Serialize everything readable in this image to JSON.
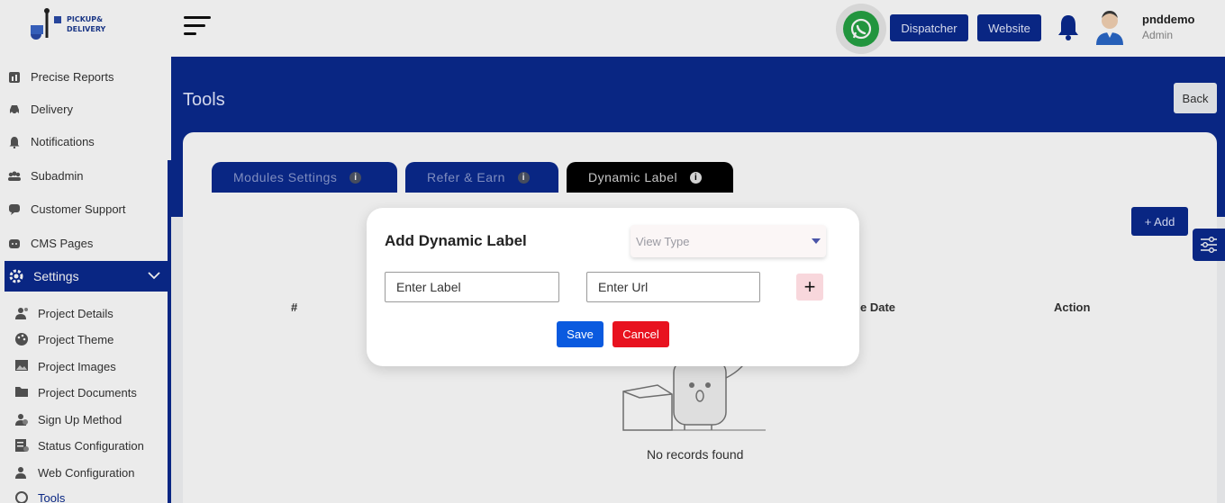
{
  "header": {
    "logo_text_line1": "PICKUP&",
    "logo_text_line2": "DELIVERY",
    "dispatcher_label": "Dispatcher",
    "website_label": "Website",
    "user_name": "pnddemo",
    "user_role": "Admin"
  },
  "sidebar": {
    "items": [
      {
        "label": "Precise Reports",
        "icon": "reports-icon"
      },
      {
        "label": "Delivery",
        "icon": "car-icon"
      },
      {
        "label": "Notifications",
        "icon": "bell-icon"
      },
      {
        "label": "Subadmin",
        "icon": "users-icon"
      },
      {
        "label": "Customer Support",
        "icon": "chat-icon"
      },
      {
        "label": "CMS Pages",
        "icon": "cms-icon"
      }
    ],
    "settings_label": "Settings",
    "sub_items": [
      {
        "label": "Project Details",
        "icon": "person-gear-icon"
      },
      {
        "label": "Project Theme",
        "icon": "palette-icon"
      },
      {
        "label": "Project Images",
        "icon": "image-icon"
      },
      {
        "label": "Project Documents",
        "icon": "folder-icon"
      },
      {
        "label": "Sign Up Method",
        "icon": "person-add-icon"
      },
      {
        "label": "Status Configuration",
        "icon": "status-icon"
      },
      {
        "label": "Web Configuration",
        "icon": "web-icon"
      },
      {
        "label": "Tools",
        "icon": "tools-icon"
      }
    ]
  },
  "main": {
    "title": "Tools",
    "back_label": "Back",
    "tabs": [
      {
        "label": "Modules Settings"
      },
      {
        "label": "Refer & Earn"
      },
      {
        "label": "Dynamic Label"
      }
    ],
    "add_label": "+ Add",
    "table_headers": [
      "#",
      "e Date",
      "Action"
    ],
    "empty_text": "No records found"
  },
  "modal": {
    "title": "Add Dynamic Label",
    "view_type_placeholder": "View Type",
    "label_placeholder": "Enter Label",
    "url_placeholder": "Enter Url",
    "plus_label": "+",
    "save_label": "Save",
    "cancel_label": "Cancel"
  },
  "colors": {
    "primary": "#0a2a8f",
    "save": "#0a5adf",
    "cancel": "#e8121f",
    "whatsapp": "#25a244"
  }
}
